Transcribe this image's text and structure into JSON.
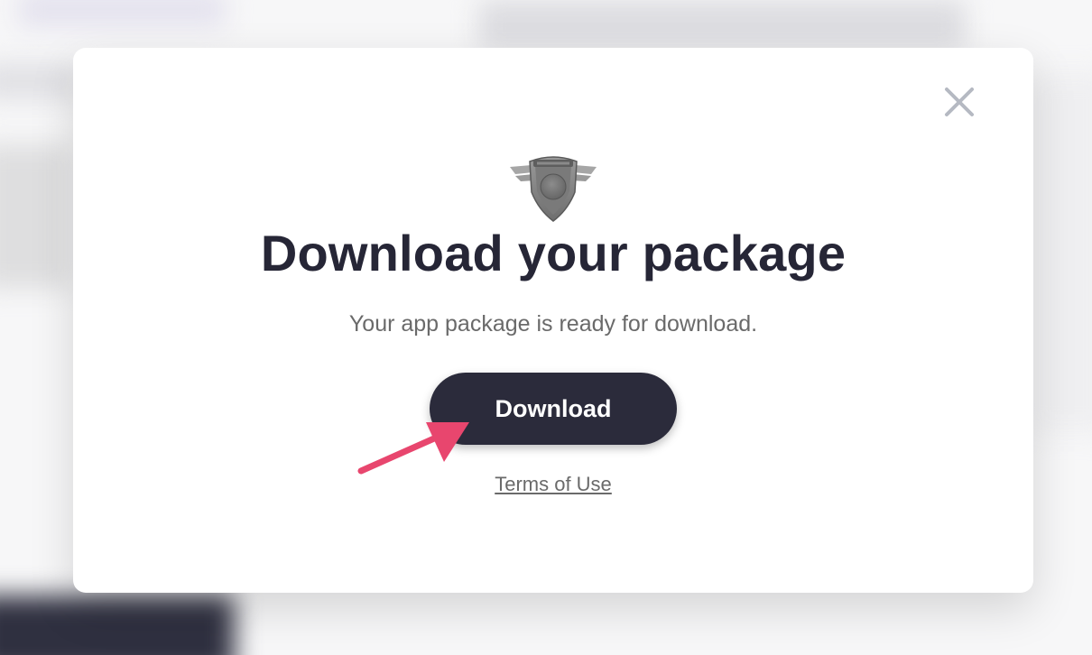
{
  "modal": {
    "title": "Download your package",
    "subtitle": "Your app package is ready for download.",
    "download_label": "Download",
    "terms_label": "Terms of Use",
    "close_icon": "close-icon",
    "logo_icon": "winged-shield-logo"
  },
  "colors": {
    "button_bg": "#2b2b3b",
    "title": "#262636",
    "text": "#6a6a6a",
    "arrow": "#e8466e",
    "close": "#b5b9c2"
  }
}
